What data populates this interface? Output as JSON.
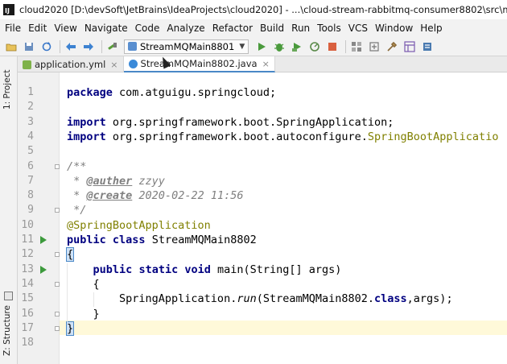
{
  "window": {
    "app_icon_text": "IJ",
    "title": "cloud2020 [D:\\devSoft\\JetBrains\\IdeaProjects\\cloud2020] - ...\\cloud-stream-rabbitmq-consumer8802\\src\\main\\java\\com\\atgu"
  },
  "menu": [
    "File",
    "Edit",
    "View",
    "Navigate",
    "Code",
    "Analyze",
    "Refactor",
    "Build",
    "Run",
    "Tools",
    "VCS",
    "Window",
    "Help"
  ],
  "toolbar": {
    "run_config": "StreamMQMain8801",
    "icons": [
      "folder-open-icon",
      "save-icon",
      "sync-icon",
      "back-icon",
      "forward-icon",
      "build-icon",
      "run-icon",
      "debug-icon",
      "coverage-icon",
      "stop-icon",
      "project-structure-icon",
      "sdk-icon",
      "settings-icon",
      "structure-icon",
      "database-icon"
    ]
  },
  "tool_windows": {
    "project": "1: Project",
    "structure": "Z: Structure"
  },
  "tabs": [
    {
      "label": "application.yml",
      "active": false
    },
    {
      "label": "StreamMQMain8802.java",
      "active": true
    }
  ],
  "editor": {
    "current_line": 17,
    "run_marker_lines": [
      11,
      13
    ],
    "lines": [
      {
        "n": 1,
        "text": "package com.atguigu.springcloud;"
      },
      {
        "n": 2,
        "text": ""
      },
      {
        "n": 3,
        "text": "import org.springframework.boot.SpringApplication;"
      },
      {
        "n": 4,
        "text": "import org.springframework.boot.autoconfigure.SpringBootApplicatio"
      },
      {
        "n": 5,
        "text": ""
      },
      {
        "n": 6,
        "text": "/**"
      },
      {
        "n": 7,
        "text": " * @auther zzyy"
      },
      {
        "n": 8,
        "text": " * @create 2020-02-22 11:56"
      },
      {
        "n": 9,
        "text": " */"
      },
      {
        "n": 10,
        "text": "@SpringBootApplication"
      },
      {
        "n": 11,
        "text": "public class StreamMQMain8802"
      },
      {
        "n": 12,
        "text": "{"
      },
      {
        "n": 13,
        "text": "    public static void main(String[] args)"
      },
      {
        "n": 14,
        "text": "    {"
      },
      {
        "n": 15,
        "text": "        SpringApplication.run(StreamMQMain8802.class,args);"
      },
      {
        "n": 16,
        "text": "    }"
      },
      {
        "n": 17,
        "text": "}"
      },
      {
        "n": 18,
        "text": ""
      }
    ]
  }
}
